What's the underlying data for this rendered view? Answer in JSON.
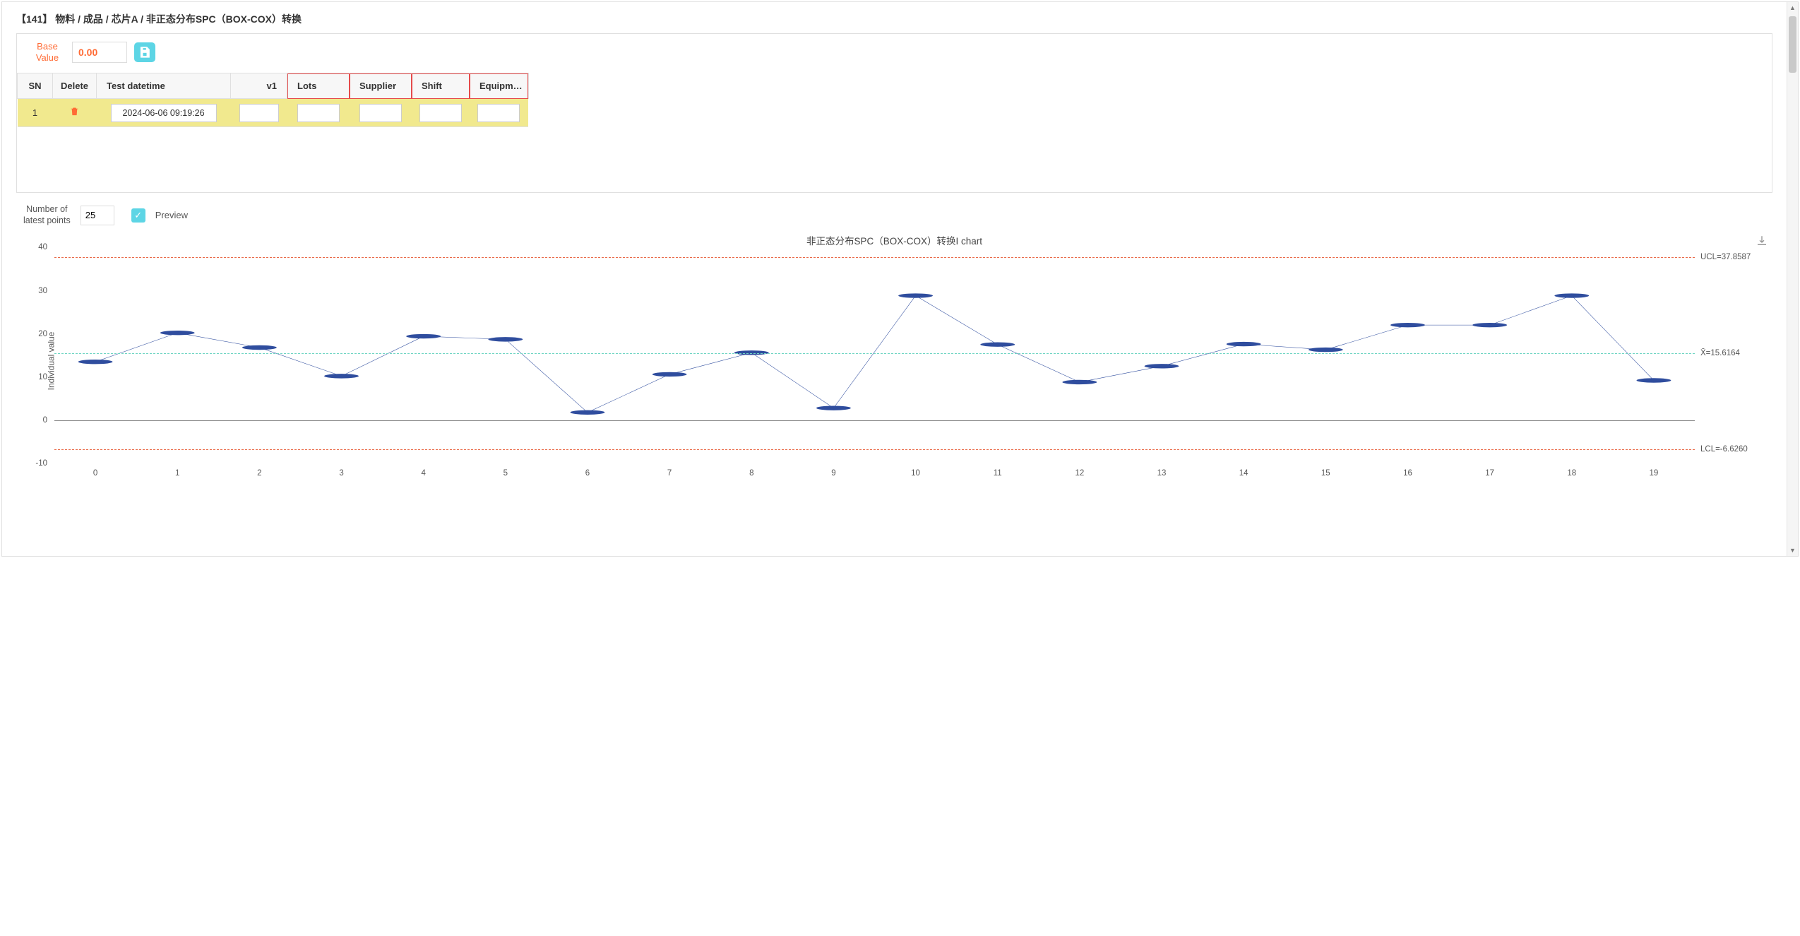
{
  "breadcrumb": "【141】 物料 / 成品 / 芯片A / 非正态分布SPC（BOX-COX）转换",
  "base": {
    "label_line1": "Base",
    "label_line2": "Value",
    "value": "0.00"
  },
  "table": {
    "headers": {
      "sn": "SN",
      "delete": "Delete",
      "datetime": "Test datetime",
      "v1": "v1",
      "lots": "Lots",
      "supplier": "Supplier",
      "shift": "Shift",
      "equipment": "Equipm…"
    },
    "rows": [
      {
        "sn": "1",
        "datetime": "2024-06-06 09:19:26",
        "v1": "",
        "lots": "",
        "supplier": "",
        "shift": "",
        "equipment": ""
      }
    ]
  },
  "latest": {
    "label_line1": "Number of",
    "label_line2": "latest points",
    "value": "25"
  },
  "preview_label": "Preview",
  "chart_data": {
    "type": "line",
    "title": "非正态分布SPC（BOX-COX）转换I chart",
    "ylabel": "Individual value",
    "y_ticks": [
      -10,
      0,
      10,
      20,
      30,
      40
    ],
    "ylim": [
      -10,
      40
    ],
    "categories": [
      "0",
      "1",
      "2",
      "3",
      "4",
      "5",
      "6",
      "7",
      "8",
      "9",
      "10",
      "11",
      "12",
      "13",
      "14",
      "15",
      "16",
      "17",
      "18",
      "19"
    ],
    "values": [
      13.5,
      20.2,
      16.8,
      10.2,
      19.4,
      18.7,
      1.8,
      10.6,
      15.6,
      2.8,
      28.8,
      17.5,
      8.8,
      12.5,
      17.6,
      16.3,
      22.0,
      22.0,
      28.8,
      9.2
    ],
    "ucl": {
      "value": 37.8587,
      "label": "UCL=37.8587"
    },
    "mean": {
      "value": 15.6164,
      "label": "X̄=15.6164"
    },
    "lcl": {
      "value": -6.626,
      "label": "LCL=-6.6260"
    }
  }
}
